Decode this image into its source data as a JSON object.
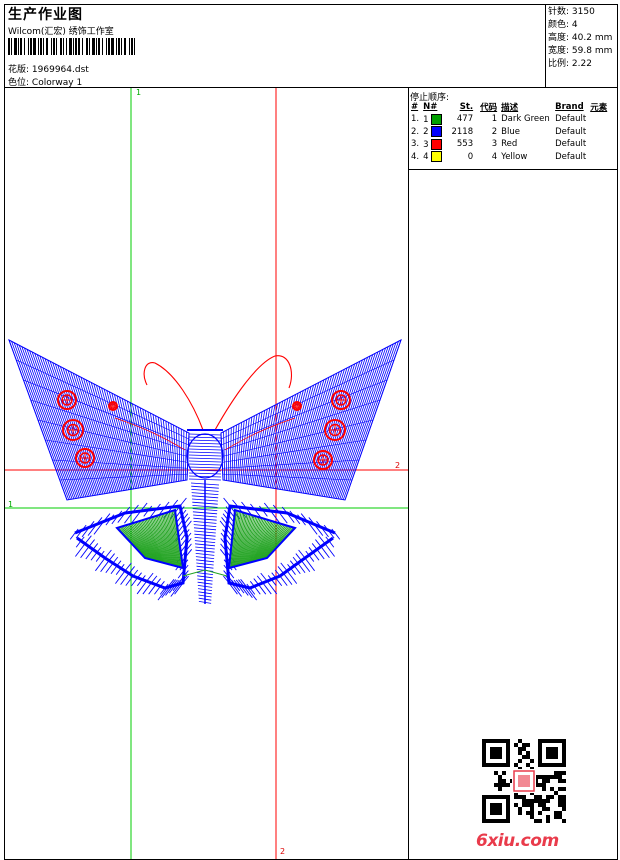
{
  "header": {
    "title": "生产作业图",
    "company": "Wilcom(汇宏) 绣饰工作室",
    "design_label": "花版:",
    "design_value": "1969964.dst",
    "colorway_label": "色位:",
    "colorway_value": "Colorway 1"
  },
  "stats": [
    {
      "label": "针数:",
      "value": "3150"
    },
    {
      "label": "颜色:",
      "value": "4"
    },
    {
      "label": "高度:",
      "value": "40.2 mm"
    },
    {
      "label": "宽度:",
      "value": "59.8 mm"
    },
    {
      "label": "比例:",
      "value": "2.22"
    }
  ],
  "stop_sequence": {
    "title": "停止顺序:",
    "headers": [
      "#",
      "N#",
      "St.",
      "代码",
      "描述",
      "Brand",
      "元素"
    ],
    "rows": [
      {
        "idx": "1.",
        "n": "1",
        "stitches": "477",
        "code": "1",
        "desc": "Dark Green",
        "brand": "Default",
        "color": "#00a000"
      },
      {
        "idx": "2.",
        "n": "2",
        "stitches": "2118",
        "code": "2",
        "desc": "Blue",
        "brand": "Default",
        "color": "#0000ff"
      },
      {
        "idx": "3.",
        "n": "3",
        "stitches": "553",
        "code": "3",
        "desc": "Red",
        "brand": "Default",
        "color": "#ff0000"
      },
      {
        "idx": "4.",
        "n": "4",
        "stitches": "0",
        "code": "4",
        "desc": "Yellow",
        "brand": "Default",
        "color": "#ffff00"
      }
    ]
  },
  "guides": {
    "green_top": "1",
    "green_left": "1",
    "red_right": "2",
    "red_bottom": "2"
  },
  "watermark": {
    "site": "6xiu.com"
  },
  "colors": {
    "green_guide": "#00cc00",
    "red_guide": "#ff0000",
    "thread_blue": "#0000ff",
    "thread_green": "#22a322",
    "thread_red": "#ff0000",
    "watermark": "#e93b4b"
  }
}
